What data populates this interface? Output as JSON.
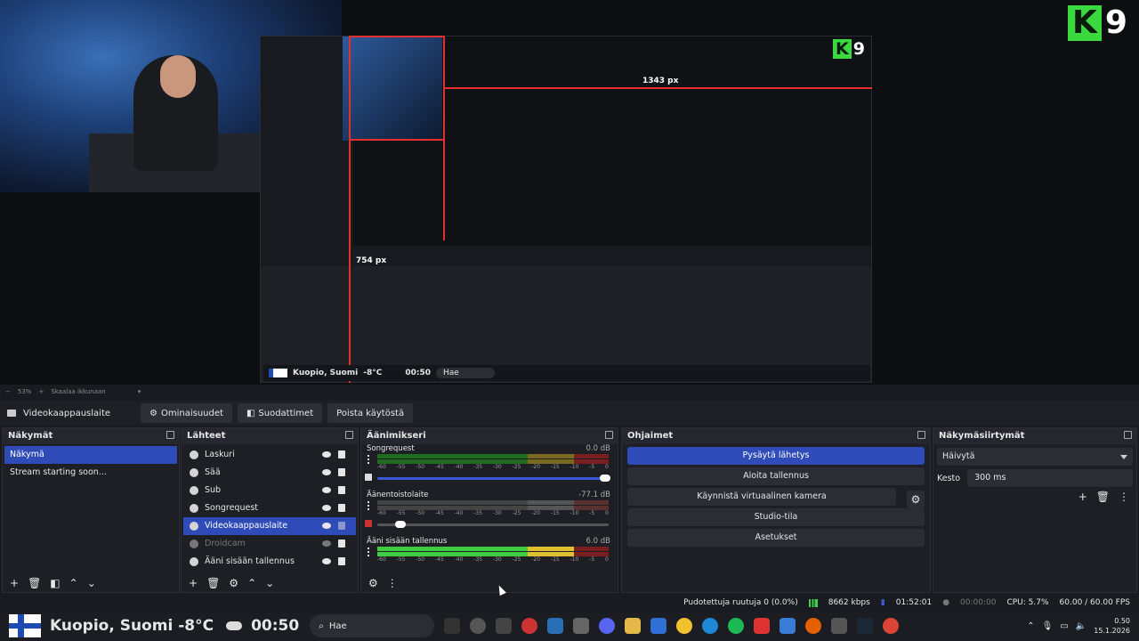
{
  "preview": {
    "logo_letter": "K",
    "logo_number": "9",
    "measure_width": "1343 px",
    "measure_height": "754 px",
    "mini_location": "Kuopio, Suomi",
    "mini_temp": "-8°C",
    "mini_time": "00:50",
    "mini_search": "Hae"
  },
  "zoom": {
    "minus": "−",
    "value": "53%",
    "plus": "+",
    "scale_label": "Skaalaa ikkunaan"
  },
  "source_toolbar": {
    "device": "Videokaappauslaite",
    "properties": "Ominaisuudet",
    "filters": "Suodattimet",
    "deactivate": "Poista käytöstä"
  },
  "scenes": {
    "title": "Näkymät",
    "items": [
      "Näkymä",
      "Stream starting soon..."
    ]
  },
  "sources": {
    "title": "Lähteet",
    "items": [
      "Laskuri",
      "Sää",
      "Sub",
      "Songrequest",
      "Videokaappauslaite",
      "Droidcam",
      "Ääni sisään tallennus"
    ]
  },
  "mixer": {
    "title": "Äänimikseri",
    "scale": [
      "-60",
      "-55",
      "-50",
      "-45",
      "-40",
      "-35",
      "-30",
      "-25",
      "-20",
      "-15",
      "-10",
      "-5",
      "0"
    ],
    "channels": [
      {
        "name": "Songrequest",
        "db": "0.0 dB",
        "volume": 1.0
      },
      {
        "name": "Äänentoistolaite",
        "db": "-77.1 dB",
        "volume": 0.1
      },
      {
        "name": "Ääni sisään tallennus",
        "db": "6.0 dB",
        "volume": 1.0
      }
    ]
  },
  "controls": {
    "title": "Ohjaimet",
    "stop_stream": "Pysäytä lähetys",
    "start_recording": "Aloita tallennus",
    "start_virtualcam": "Käynnistä virtuaalinen kamera",
    "studio_mode": "Studio-tila",
    "settings": "Asetukset"
  },
  "transitions": {
    "title": "Näkymäsiirtymät",
    "selected": "Häivytä",
    "duration_label": "Kesto",
    "duration_value": "300 ms"
  },
  "status": {
    "dropped": "Pudotettuja ruutuja 0 (0.0%)",
    "bitrate": "8662 kbps",
    "live_time": "01:52:01",
    "rec_time": "00:00:00",
    "cpu": "CPU: 5.7%",
    "fps": "60.00 / 60.00 FPS"
  },
  "taskbar": {
    "location": "Kuopio, Suomi",
    "temp": "-8°C",
    "time_overlay": "00:50",
    "search": "Hae",
    "clock_time": "0.50",
    "clock_date": "15.1.2026"
  },
  "colors": {
    "accent": "#2f4bb8",
    "green_logo": "#39d93f",
    "red_guide": "#e53030"
  }
}
